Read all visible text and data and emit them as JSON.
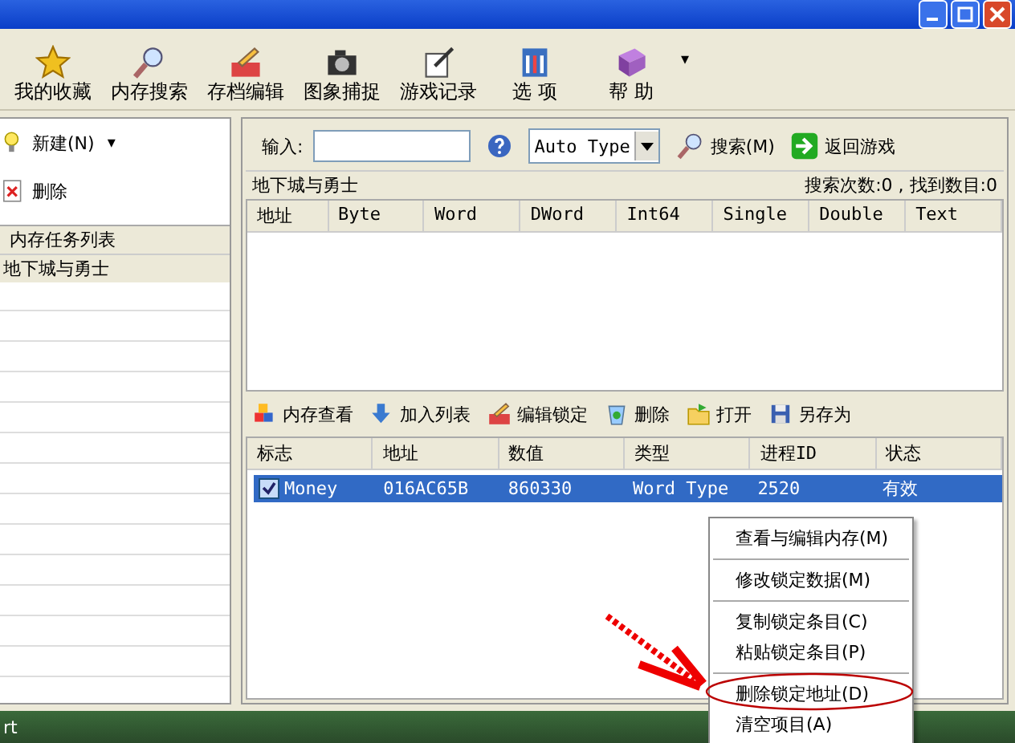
{
  "toolbar": {
    "items": [
      {
        "label": "我的收藏",
        "kind": "star"
      },
      {
        "label": "内存搜索",
        "kind": "search"
      },
      {
        "label": "存档编辑",
        "kind": "edit"
      },
      {
        "label": "图象捕捉",
        "kind": "camera"
      },
      {
        "label": "游戏记录",
        "kind": "pen"
      },
      {
        "label": "选 项",
        "kind": "options"
      },
      {
        "label": "帮 助",
        "kind": "book"
      }
    ],
    "more": "▾"
  },
  "left_panel": {
    "actions": [
      {
        "label": "新建(N)",
        "kind": "bulb",
        "dropdown": "▾"
      },
      {
        "label": "删除",
        "kind": "delete"
      }
    ],
    "list": {
      "header": "内存任务列表",
      "items": [
        {
          "label": "地下城与勇士",
          "selected": true
        }
      ]
    }
  },
  "search": {
    "label": "输入:",
    "type": "Auto Type",
    "buttons": [
      {
        "label": "搜索(M)",
        "kind": "search"
      },
      {
        "label": "返回游戏",
        "kind": "arrow"
      }
    ],
    "game": "地下城与勇士",
    "stats": "搜索次数:0 , 找到数目:0"
  },
  "results_table": {
    "columns": [
      "地址",
      "Byte",
      "Word",
      "DWord",
      "Int64",
      "Single",
      "Double",
      "Text"
    ]
  },
  "lock_toolbar": [
    {
      "label": "内存查看",
      "kind": "blocks"
    },
    {
      "label": "加入列表",
      "kind": "down"
    },
    {
      "label": "编辑锁定",
      "kind": "edit"
    },
    {
      "label": "删除",
      "kind": "recycle"
    },
    {
      "label": "打开",
      "kind": "folder"
    },
    {
      "label": "另存为",
      "kind": "disk"
    }
  ],
  "lock_table": {
    "columns": [
      "标志",
      "地址",
      "数值",
      "类型",
      "进程ID",
      "状态"
    ],
    "rows": [
      {
        "checked": true,
        "selected": true,
        "cells": [
          "Money",
          "016AC65B",
          "860330",
          "Word Type",
          "2520",
          "有效"
        ]
      }
    ]
  },
  "context_menu": [
    {
      "kind": "item",
      "label": "查看与编辑内存(M)"
    },
    {
      "kind": "separator"
    },
    {
      "kind": "item",
      "label": "修改锁定数据(M)"
    },
    {
      "kind": "separator"
    },
    {
      "kind": "item",
      "label": "复制锁定条目(C)"
    },
    {
      "kind": "item",
      "label": "粘贴锁定条目(P)"
    },
    {
      "kind": "separator"
    },
    {
      "kind": "item",
      "label": "删除锁定地址(D)"
    },
    {
      "kind": "item",
      "label": "清空项目(A)"
    }
  ],
  "taskbar": {
    "start": "rt"
  }
}
